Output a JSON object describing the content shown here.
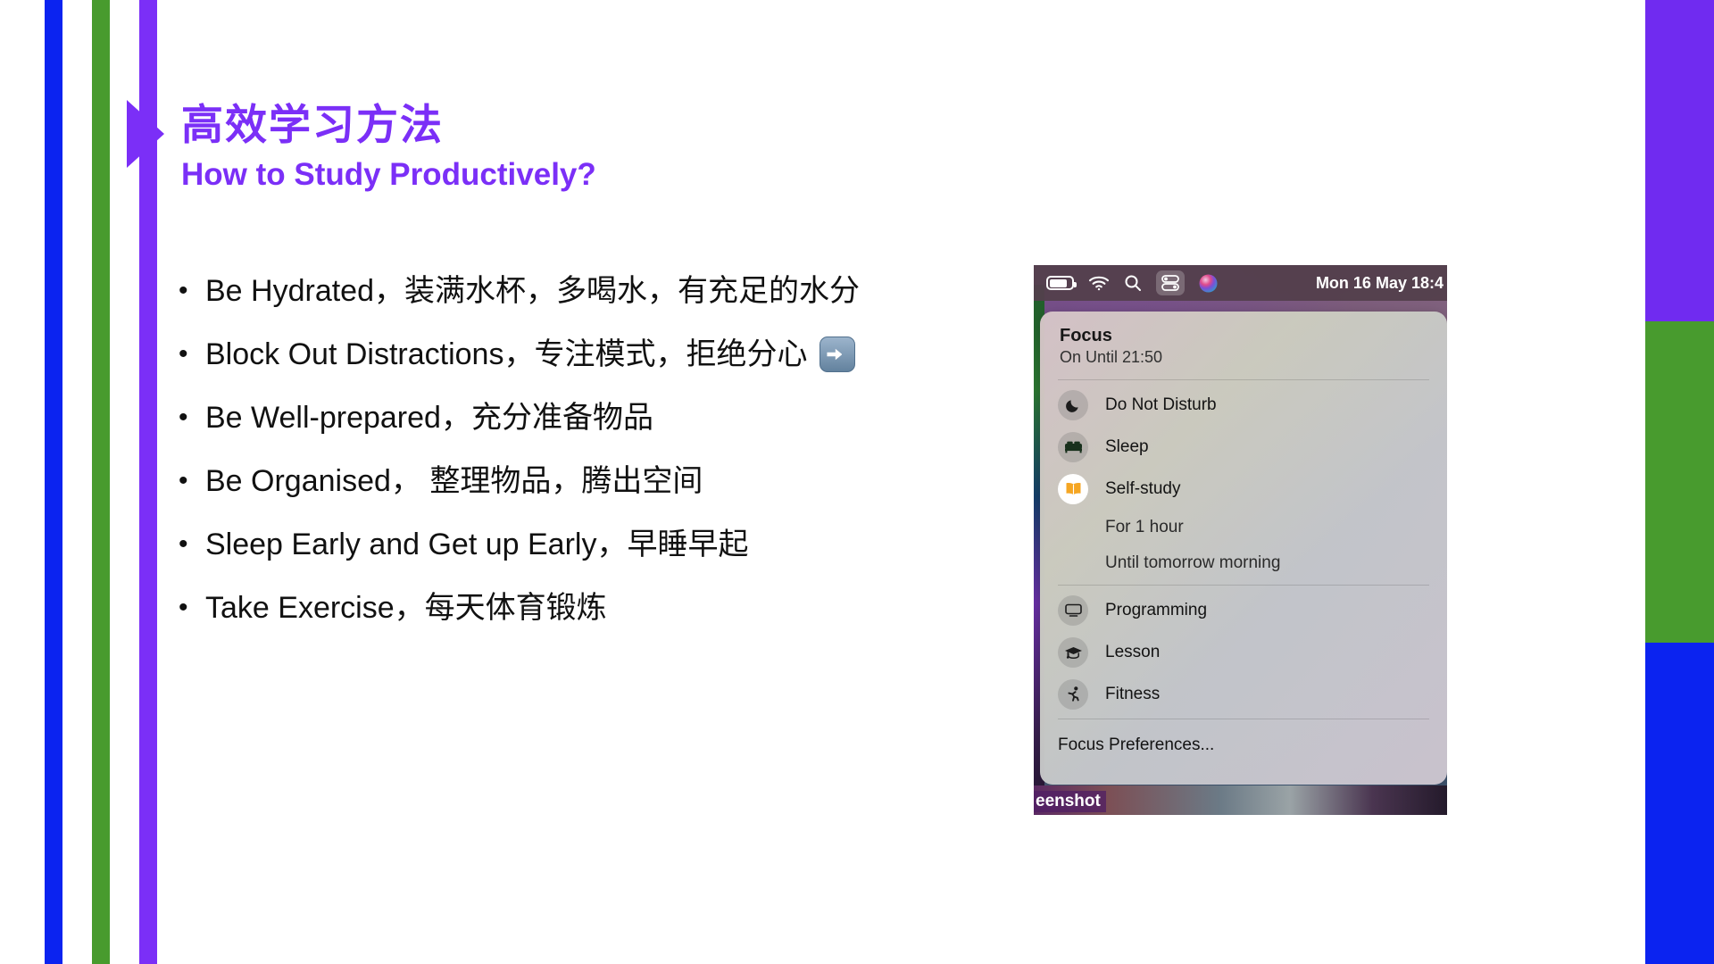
{
  "slide": {
    "title": "高效学习方法",
    "subtitle": "How to Study Productively?",
    "bullets": [
      {
        "marker": "•",
        "text": "Be Hydrated，装满水杯，多喝水，有充足的水分",
        "emoji": ""
      },
      {
        "marker": "•",
        "text": "Block Out Distractions，专注模式，拒绝分心",
        "emoji": "right-arrow-emoji"
      },
      {
        "marker": "•",
        "text": "Be Well-prepared，充分准备物品",
        "emoji": ""
      },
      {
        "marker": "•",
        "text": "Be Organised， 整理物品，腾出空间",
        "emoji": ""
      },
      {
        "marker": "•",
        "text": "Sleep Early and Get up Early，早睡早起",
        "emoji": ""
      },
      {
        "marker": "•",
        "text": "Take Exercise，每天体育锻炼",
        "emoji": ""
      }
    ]
  },
  "decor": {
    "left_stripes": [
      {
        "name": "blue",
        "color": "#0b23f0"
      },
      {
        "name": "green",
        "color": "#489b2e"
      },
      {
        "name": "purple",
        "color": "#7b2ff7"
      }
    ],
    "right_blocks": [
      {
        "name": "purple",
        "color": "#702bf0"
      },
      {
        "name": "green",
        "color": "#489b2e"
      },
      {
        "name": "blue",
        "color": "#0b23f0"
      }
    ],
    "accent_color": "#7b2ff7"
  },
  "screenshot": {
    "menubar": {
      "icons": [
        "battery-icon",
        "wifi-icon",
        "search-icon",
        "control-center-icon",
        "siri-icon"
      ],
      "clock": "Mon 16 May  18:4"
    },
    "focus_menu": {
      "title": "Focus",
      "status": "On Until 21:50",
      "items": [
        {
          "label": "Do Not Disturb",
          "icon": "moon-icon",
          "active": false
        },
        {
          "label": "Sleep",
          "icon": "bed-icon",
          "active": false
        },
        {
          "label": "Self-study",
          "icon": "book-icon",
          "active": true
        }
      ],
      "duration_options": [
        "For 1 hour",
        "Until tomorrow morning"
      ],
      "more_items": [
        {
          "label": "Programming",
          "icon": "display-icon",
          "active": false
        },
        {
          "label": "Lesson",
          "icon": "graduation-cap-icon",
          "active": false
        },
        {
          "label": "Fitness",
          "icon": "running-icon",
          "active": false
        }
      ],
      "preferences_label": "Focus Preferences..."
    },
    "watermark": "eenshot"
  }
}
